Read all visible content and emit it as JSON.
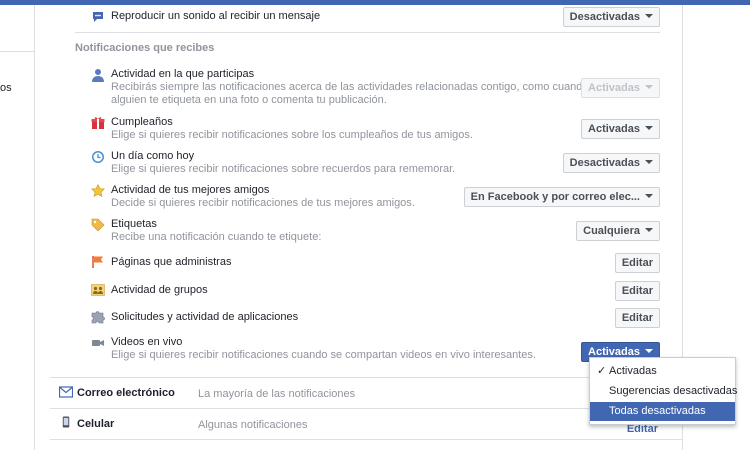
{
  "left_nav_fragment": "os",
  "sound_row": {
    "title": "Reproducir un sonido al recibir un mensaje",
    "button": "Desactivadas",
    "icon": "chat-bubble-icon"
  },
  "section_title": "Notificaciones que recibes",
  "items": [
    {
      "title": "Actividad en la que participas",
      "desc1": "Recibirás siempre las notificaciones acerca de las actividades relacionadas contigo, como cuando",
      "desc2": "alguien te etiqueta en una foto o comenta tu publicación.",
      "button": "Activadas",
      "icon": "person-icon",
      "state": "disabled"
    },
    {
      "title": "Cumpleaños",
      "desc1": "Elige si quieres recibir notificaciones sobre los cumpleaños de tus amigos.",
      "button": "Activadas",
      "icon": "gift-icon",
      "state": "normal"
    },
    {
      "title": "Un día como hoy",
      "desc1": "Elige si quieres recibir notificaciones sobre recuerdos para rememorar.",
      "button": "Desactivadas",
      "icon": "clock-icon",
      "state": "normal"
    },
    {
      "title": "Actividad de tus mejores amigos",
      "desc1": "Decide si quieres recibir notificaciones de tus mejores amigos.",
      "button": "En Facebook y por correo elec...",
      "icon": "star-friend-icon",
      "state": "normal"
    },
    {
      "title": "Etiquetas",
      "desc1": "Recibe una notificación cuando te etiquete:",
      "button": "Cualquiera",
      "icon": "tag-icon",
      "state": "normal"
    },
    {
      "title": "Páginas que administras",
      "button": "Editar",
      "icon": "flag-icon",
      "state": "edit"
    },
    {
      "title": "Actividad de grupos",
      "button": "Editar",
      "icon": "groups-icon",
      "state": "edit"
    },
    {
      "title": "Solicitudes y actividad de aplicaciones",
      "button": "Editar",
      "icon": "puzzle-icon",
      "state": "edit"
    },
    {
      "title": "Videos en vivo",
      "desc1": "Elige si quieres recibir notificaciones cuando se compartan videos en vivo interesantes.",
      "button": "Activadas",
      "icon": "video-camera-icon",
      "state": "active"
    }
  ],
  "lower_rows": [
    {
      "title": "Correo electrónico",
      "desc": "La mayoría de las notificaciones",
      "icon": "envelope-icon"
    },
    {
      "title": "Celular",
      "desc": "Algunas notificaciones",
      "link": "Editar",
      "icon": "phone-icon"
    }
  ],
  "dropdown": {
    "options": [
      "Activadas",
      "Sugerencias desactivadas",
      "Todas desactivadas"
    ],
    "checked_index": 0,
    "highlighted_index": 2
  },
  "colors": {
    "brand": "#4267b2",
    "muted": "#90949c",
    "text": "#1d2129"
  }
}
